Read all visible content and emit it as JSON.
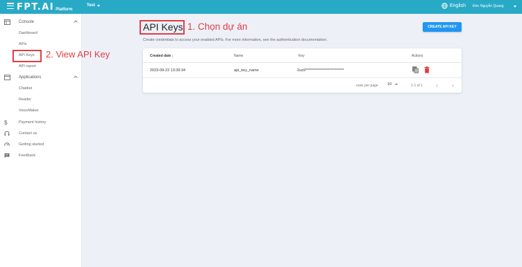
{
  "header": {
    "logo_text": "FPT.AI",
    "logo_sub": "Platform",
    "project": "Test",
    "language": "English",
    "user_name": "Đức Nguyễn Quang"
  },
  "sidebar": {
    "groups": [
      {
        "label": "Console",
        "icon": "console-icon",
        "items": [
          "Dashboard",
          "APIs",
          "API Keys",
          "API report"
        ]
      },
      {
        "label": "Applications",
        "icon": "applications-icon",
        "items": [
          "Chatbot",
          "Reader",
          "VoiceMaker"
        ]
      }
    ],
    "links": [
      {
        "label": "Payment history",
        "icon": "dollar-icon"
      },
      {
        "label": "Contact us",
        "icon": "headset-icon"
      },
      {
        "label": "Getting started",
        "icon": "speedometer-icon"
      },
      {
        "label": "Feedback",
        "icon": "feedback-icon"
      }
    ]
  },
  "annotations": {
    "step1": "1. Chọn dự án",
    "step2": "2. View API Key",
    "color": "#e03d42"
  },
  "main": {
    "title": "API Keys",
    "subtitle": "Create credentials to access your enabled APIs. For more information, see the authentication documentation.",
    "create_button": "CREATE API KEY",
    "table": {
      "headers": [
        "Created date",
        "Name",
        "Key",
        "Actions"
      ],
      "rows": [
        {
          "created": "2023-09-22 13:39:34",
          "name": "api_key_name",
          "key": "2uz9**************************"
        }
      ]
    },
    "footer": {
      "rows_per_page_label": "rows per page",
      "rows_per_page_value": "10",
      "range": "1-1 of 1"
    }
  },
  "colors": {
    "topbar": "#28aac7",
    "accent_button": "#2196f3",
    "delete_icon": "#e53935"
  }
}
